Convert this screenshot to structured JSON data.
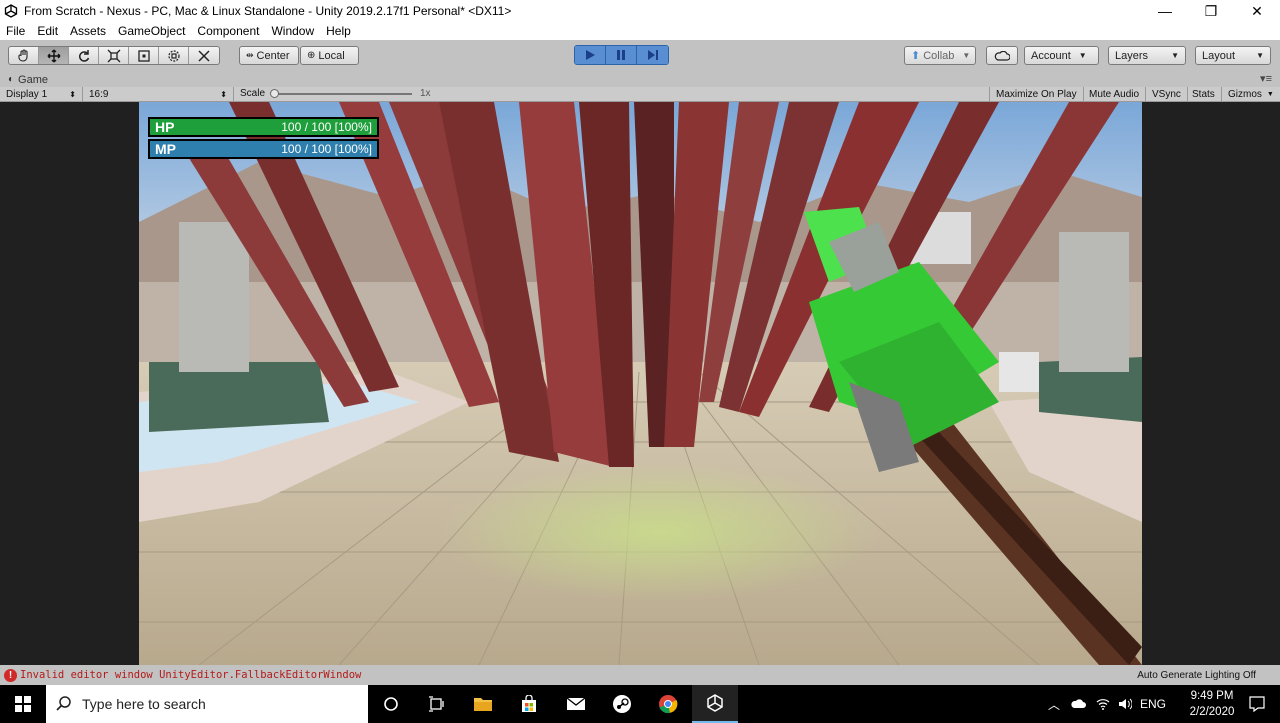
{
  "window": {
    "title": "From Scratch - Nexus - PC, Mac & Linux Standalone - Unity 2019.2.17f1 Personal* <DX11>",
    "minimize_symbol": "—",
    "restore_symbol": "❐",
    "close_symbol": "✕"
  },
  "menu": [
    "File",
    "Edit",
    "Assets",
    "GameObject",
    "Component",
    "Window",
    "Help"
  ],
  "toolbar": {
    "pivot_label": "Center",
    "space_label": "Local",
    "collab_label": "Collab",
    "account_label": "Account",
    "layers_label": "Layers",
    "layout_label": "Layout"
  },
  "game_tab": {
    "label": "Game"
  },
  "game_bar": {
    "display": "Display 1",
    "aspect": "16:9",
    "scale_label": "Scale",
    "scale_value": "1x",
    "maximize": "Maximize On Play",
    "mute": "Mute Audio",
    "vsync": "VSync",
    "stats": "Stats",
    "gizmos": "Gizmos"
  },
  "hud": {
    "hp_label": "HP",
    "hp_value": "100 / 100  [100%]",
    "hp_fraction": 1.0,
    "mp_label": "MP",
    "mp_value": "100 / 100  [100%]",
    "mp_fraction": 1.0
  },
  "status": {
    "error": "Invalid editor window UnityEditor.FallbackEditorWindow",
    "lighting": "Auto Generate Lighting Off"
  },
  "taskbar": {
    "search_placeholder": "Type here to search",
    "lang": "ENG",
    "time": "9:49 PM",
    "date": "2/2/2020"
  }
}
